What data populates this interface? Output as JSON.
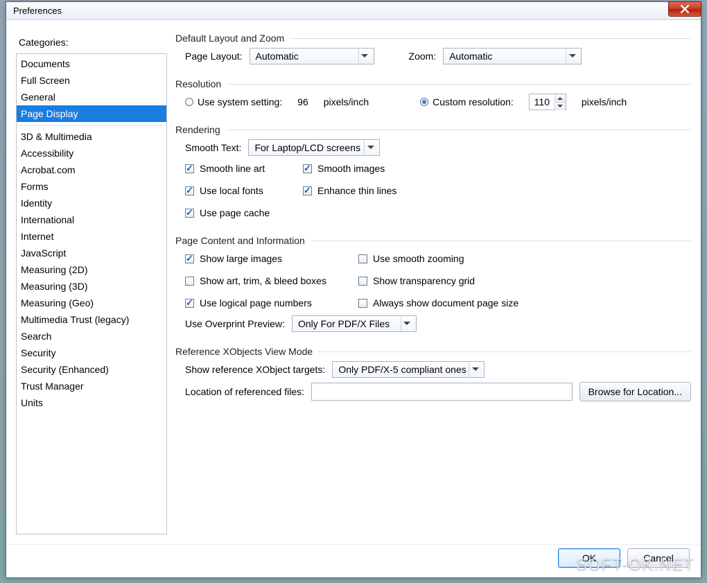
{
  "window": {
    "title": "Preferences"
  },
  "sidebar": {
    "label": "Categories:",
    "group1": [
      {
        "label": "Documents",
        "selected": false
      },
      {
        "label": "Full Screen",
        "selected": false
      },
      {
        "label": "General",
        "selected": false
      },
      {
        "label": "Page Display",
        "selected": true
      }
    ],
    "group2": [
      "3D & Multimedia",
      "Accessibility",
      "Acrobat.com",
      "Forms",
      "Identity",
      "International",
      "Internet",
      "JavaScript",
      "Measuring (2D)",
      "Measuring (3D)",
      "Measuring (Geo)",
      "Multimedia Trust (legacy)",
      "Search",
      "Security",
      "Security (Enhanced)",
      "Trust Manager",
      "Units"
    ]
  },
  "layoutZoom": {
    "heading": "Default Layout and Zoom",
    "pageLayoutLabel": "Page Layout:",
    "pageLayoutValue": "Automatic",
    "zoomLabel": "Zoom:",
    "zoomValue": "Automatic"
  },
  "resolution": {
    "heading": "Resolution",
    "sysRadio": "Use system setting:",
    "sysValue": "96",
    "unit": "pixels/inch",
    "customRadio": "Custom resolution:",
    "customValue": "110",
    "selected": "custom"
  },
  "rendering": {
    "heading": "Rendering",
    "smoothTextLabel": "Smooth Text:",
    "smoothTextValue": "For Laptop/LCD screens",
    "checks": [
      {
        "key": "smooth-line-art",
        "label": "Smooth line art",
        "checked": true
      },
      {
        "key": "smooth-images",
        "label": "Smooth images",
        "checked": true
      },
      {
        "key": "use-local-fonts",
        "label": "Use local fonts",
        "checked": true
      },
      {
        "key": "enhance-thin-lines",
        "label": "Enhance thin lines",
        "checked": true
      },
      {
        "key": "use-page-cache",
        "label": "Use page cache",
        "checked": true
      }
    ]
  },
  "pageContent": {
    "heading": "Page Content and Information",
    "checks": [
      {
        "key": "show-large-images",
        "label": "Show large images",
        "checked": true
      },
      {
        "key": "use-smooth-zoom",
        "label": "Use smooth zooming",
        "checked": false
      },
      {
        "key": "show-art-trim",
        "label": "Show art, trim, & bleed boxes",
        "checked": false
      },
      {
        "key": "show-transparency",
        "label": "Show transparency grid",
        "checked": false
      },
      {
        "key": "use-logical-page",
        "label": "Use logical page numbers",
        "checked": true
      },
      {
        "key": "always-show-doc-size",
        "label": "Always show document page size",
        "checked": false
      }
    ],
    "overprintLabel": "Use Overprint Preview:",
    "overprintValue": "Only For PDF/X Files"
  },
  "refX": {
    "heading": "Reference XObjects View Mode",
    "targetsLabel": "Show reference XObject targets:",
    "targetsValue": "Only PDF/X-5 compliant ones",
    "locationLabel": "Location of referenced files:",
    "locationValue": "",
    "browseLabel": "Browse for Location..."
  },
  "footer": {
    "ok": "OK",
    "cancel": "Cancel"
  },
  "watermark": "SOFT-OK.NET"
}
